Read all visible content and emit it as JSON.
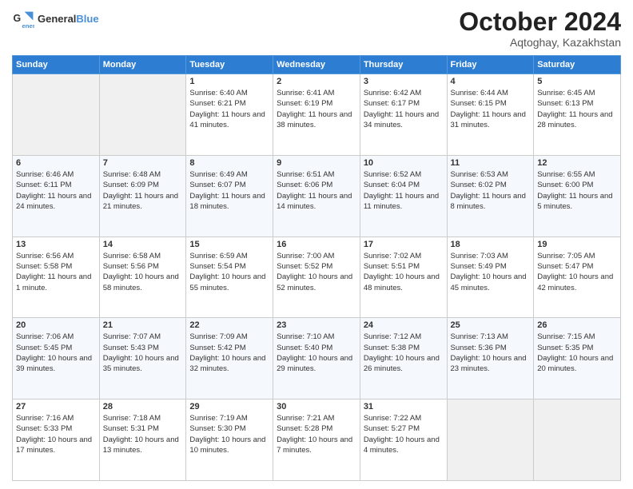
{
  "header": {
    "logo_line1": "General",
    "logo_line2": "Blue",
    "main_title": "October 2024",
    "subtitle": "Aqtoghay, Kazakhstan"
  },
  "days_of_week": [
    "Sunday",
    "Monday",
    "Tuesday",
    "Wednesday",
    "Thursday",
    "Friday",
    "Saturday"
  ],
  "weeks": [
    [
      {
        "day": "",
        "info": ""
      },
      {
        "day": "",
        "info": ""
      },
      {
        "day": "1",
        "info": "Sunrise: 6:40 AM\nSunset: 6:21 PM\nDaylight: 11 hours and 41 minutes."
      },
      {
        "day": "2",
        "info": "Sunrise: 6:41 AM\nSunset: 6:19 PM\nDaylight: 11 hours and 38 minutes."
      },
      {
        "day": "3",
        "info": "Sunrise: 6:42 AM\nSunset: 6:17 PM\nDaylight: 11 hours and 34 minutes."
      },
      {
        "day": "4",
        "info": "Sunrise: 6:44 AM\nSunset: 6:15 PM\nDaylight: 11 hours and 31 minutes."
      },
      {
        "day": "5",
        "info": "Sunrise: 6:45 AM\nSunset: 6:13 PM\nDaylight: 11 hours and 28 minutes."
      }
    ],
    [
      {
        "day": "6",
        "info": "Sunrise: 6:46 AM\nSunset: 6:11 PM\nDaylight: 11 hours and 24 minutes."
      },
      {
        "day": "7",
        "info": "Sunrise: 6:48 AM\nSunset: 6:09 PM\nDaylight: 11 hours and 21 minutes."
      },
      {
        "day": "8",
        "info": "Sunrise: 6:49 AM\nSunset: 6:07 PM\nDaylight: 11 hours and 18 minutes."
      },
      {
        "day": "9",
        "info": "Sunrise: 6:51 AM\nSunset: 6:06 PM\nDaylight: 11 hours and 14 minutes."
      },
      {
        "day": "10",
        "info": "Sunrise: 6:52 AM\nSunset: 6:04 PM\nDaylight: 11 hours and 11 minutes."
      },
      {
        "day": "11",
        "info": "Sunrise: 6:53 AM\nSunset: 6:02 PM\nDaylight: 11 hours and 8 minutes."
      },
      {
        "day": "12",
        "info": "Sunrise: 6:55 AM\nSunset: 6:00 PM\nDaylight: 11 hours and 5 minutes."
      }
    ],
    [
      {
        "day": "13",
        "info": "Sunrise: 6:56 AM\nSunset: 5:58 PM\nDaylight: 11 hours and 1 minute."
      },
      {
        "day": "14",
        "info": "Sunrise: 6:58 AM\nSunset: 5:56 PM\nDaylight: 10 hours and 58 minutes."
      },
      {
        "day": "15",
        "info": "Sunrise: 6:59 AM\nSunset: 5:54 PM\nDaylight: 10 hours and 55 minutes."
      },
      {
        "day": "16",
        "info": "Sunrise: 7:00 AM\nSunset: 5:52 PM\nDaylight: 10 hours and 52 minutes."
      },
      {
        "day": "17",
        "info": "Sunrise: 7:02 AM\nSunset: 5:51 PM\nDaylight: 10 hours and 48 minutes."
      },
      {
        "day": "18",
        "info": "Sunrise: 7:03 AM\nSunset: 5:49 PM\nDaylight: 10 hours and 45 minutes."
      },
      {
        "day": "19",
        "info": "Sunrise: 7:05 AM\nSunset: 5:47 PM\nDaylight: 10 hours and 42 minutes."
      }
    ],
    [
      {
        "day": "20",
        "info": "Sunrise: 7:06 AM\nSunset: 5:45 PM\nDaylight: 10 hours and 39 minutes."
      },
      {
        "day": "21",
        "info": "Sunrise: 7:07 AM\nSunset: 5:43 PM\nDaylight: 10 hours and 35 minutes."
      },
      {
        "day": "22",
        "info": "Sunrise: 7:09 AM\nSunset: 5:42 PM\nDaylight: 10 hours and 32 minutes."
      },
      {
        "day": "23",
        "info": "Sunrise: 7:10 AM\nSunset: 5:40 PM\nDaylight: 10 hours and 29 minutes."
      },
      {
        "day": "24",
        "info": "Sunrise: 7:12 AM\nSunset: 5:38 PM\nDaylight: 10 hours and 26 minutes."
      },
      {
        "day": "25",
        "info": "Sunrise: 7:13 AM\nSunset: 5:36 PM\nDaylight: 10 hours and 23 minutes."
      },
      {
        "day": "26",
        "info": "Sunrise: 7:15 AM\nSunset: 5:35 PM\nDaylight: 10 hours and 20 minutes."
      }
    ],
    [
      {
        "day": "27",
        "info": "Sunrise: 7:16 AM\nSunset: 5:33 PM\nDaylight: 10 hours and 17 minutes."
      },
      {
        "day": "28",
        "info": "Sunrise: 7:18 AM\nSunset: 5:31 PM\nDaylight: 10 hours and 13 minutes."
      },
      {
        "day": "29",
        "info": "Sunrise: 7:19 AM\nSunset: 5:30 PM\nDaylight: 10 hours and 10 minutes."
      },
      {
        "day": "30",
        "info": "Sunrise: 7:21 AM\nSunset: 5:28 PM\nDaylight: 10 hours and 7 minutes."
      },
      {
        "day": "31",
        "info": "Sunrise: 7:22 AM\nSunset: 5:27 PM\nDaylight: 10 hours and 4 minutes."
      },
      {
        "day": "",
        "info": ""
      },
      {
        "day": "",
        "info": ""
      }
    ]
  ]
}
